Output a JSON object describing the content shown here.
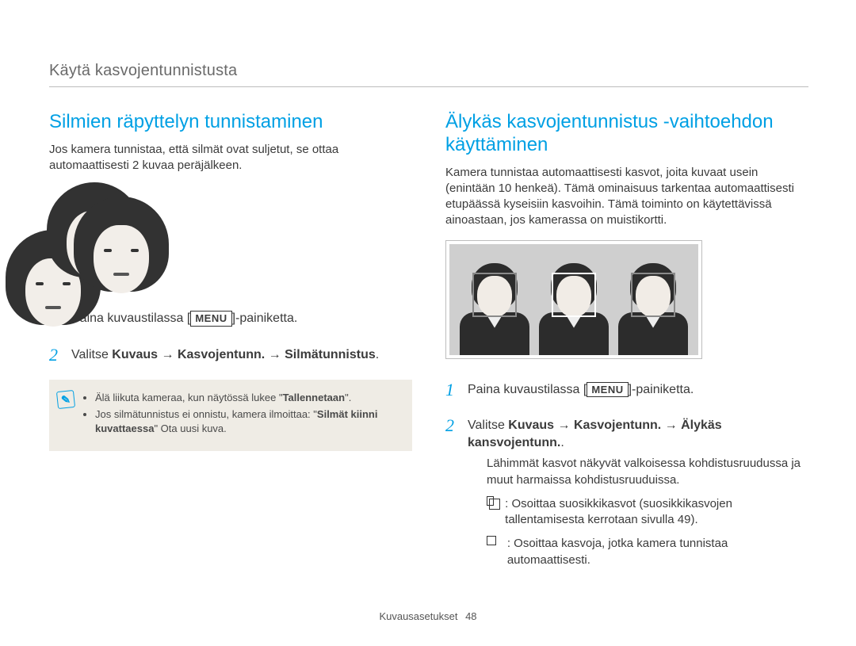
{
  "breadcrumb": "Käytä kasvojentunnistusta",
  "left": {
    "heading": "Silmien räpyttelyn tunnistaminen",
    "intro": "Jos kamera tunnistaa, että silmät ovat suljetut, se ottaa automaattisesti 2 kuvaa peräjälkeen.",
    "step1_pre": "Paina kuvaustilassa [",
    "menu_label": "MENU",
    "step1_post": "]-painiketta.",
    "step2_pre": "Valitse ",
    "step2_bold": "Kuvaus → Kasvojentunn. → Silmätunnistus",
    "step2_post": ".",
    "note1_pre": "Älä liikuta kameraa, kun näytössä lukee \"",
    "note1_bold": "Tallennetaan",
    "note1_post": "\".",
    "note2_pre": "Jos silmätunnistus ei onnistu, kamera ilmoittaa: \"",
    "note2_bold": "Silmät kiinni kuvattaessa",
    "note2_post": "\" Ota uusi kuva."
  },
  "right": {
    "heading": "Älykäs kasvojentunnistus -vaihtoehdon käyttäminen",
    "intro": "Kamera tunnistaa automaattisesti kasvot, joita kuvaat usein (enintään 10 henkeä). Tämä ominaisuus tarkentaa automaattisesti etupäässä kyseisiin kasvoihin. Tämä toiminto on käytettävissä ainoastaan, jos kamerassa on muistikortti.",
    "step1_pre": "Paina kuvaustilassa [",
    "menu_label": "MENU",
    "step1_post": "]-painiketta.",
    "step2_pre": "Valitse ",
    "step2_bold": "Kuvaus → Kasvojentunn. → Älykäs kansvojentunn.",
    "step2_post": ".",
    "sub1": "Lähimmät kasvot näkyvät valkoisessa kohdistusruudussa ja muut harmaissa kohdistusruuduissa.",
    "sub2": ": Osoittaa suosikkikasvot (suosikkikasvojen tallentamisesta kerrotaan sivulla 49).",
    "sub3": ": Osoittaa kasvoja, jotka kamera tunnistaa automaattisesti."
  },
  "footer_label": "Kuvausasetukset",
  "footer_page": "48"
}
